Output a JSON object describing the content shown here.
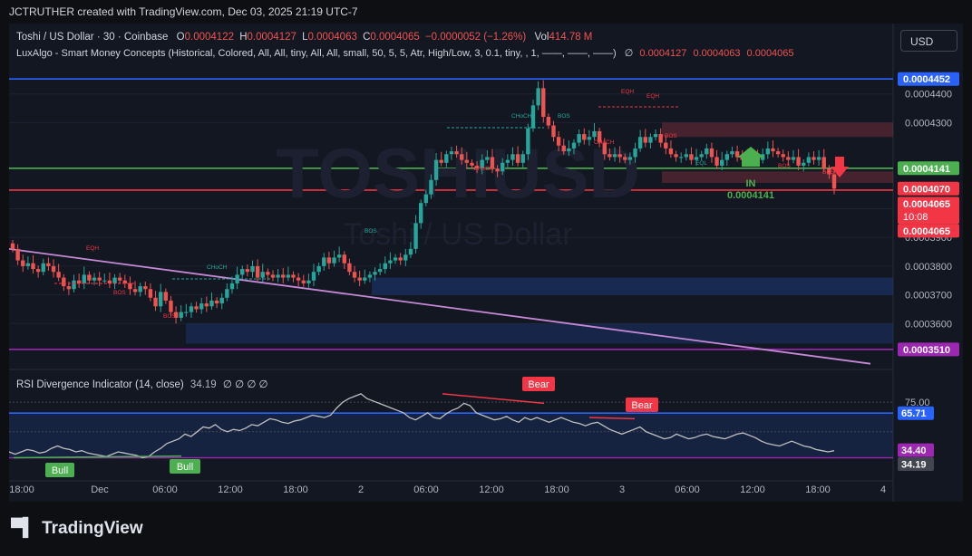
{
  "header": {
    "attribution": "JCTRUTHER created with TradingView.com, Dec 03, 2025 21:19 UTC-7"
  },
  "symbol_legend": {
    "symbol": "Toshi / US Dollar · 30 · Coinbase",
    "o_label": "O",
    "o": "0.0004122",
    "h_label": "H",
    "h": "0.0004127",
    "l_label": "L",
    "l": "0.0004063",
    "c_label": "C",
    "c": "0.0004065",
    "change": "−0.0000052 (−1.26%)",
    "vol_label": "Vol",
    "vol": "414.78 M"
  },
  "indicator_legend": {
    "smc": "LuxAlgo - Smart Money Concepts (Historical, Colored, All, All, tiny, All, All, small, 50, 5, 5, Atr, High/Low, 3, 0.1, tiny, , 1, ——, ——, ——)",
    "smc_values": [
      "∅",
      "0.0004127",
      "0.0004063",
      "0.0004065"
    ],
    "rsi": "RSI Divergence Indicator (14, close)",
    "rsi_value": "34.19",
    "rsi_extra": "∅ ∅ ∅ ∅"
  },
  "currency_button": "USD",
  "watermark": {
    "ticker": "TOSHIUSD",
    "name": "Toshi / US Dollar"
  },
  "colors": {
    "up": "#26a69a",
    "down": "#ef5350",
    "background": "#131722",
    "trendline": "#c689d6",
    "rsi_line": "#c0c0c0",
    "bull_label": "#4caf50",
    "bear_label": "#f23645",
    "blue_line": "#2962ff"
  },
  "annotations": {
    "entry_label": "IN",
    "entry_price": "0.0004141",
    "smc_labels": [
      "EQH",
      "EQH",
      "EQH",
      "CHoCH",
      "CHoCH",
      "CHoCH",
      "CHoCH",
      "BOS",
      "BOS",
      "BOS",
      "BOS",
      "BOS",
      "BOS",
      "BOS",
      "EQL"
    ],
    "rsi_bull": [
      "Bull",
      "Bull"
    ],
    "rsi_bear": [
      "Bear",
      "Bear"
    ]
  },
  "chart_data": {
    "type": "candlestick",
    "price_axis": {
      "range": [
        0.00035,
        0.00045
      ],
      "ticks": [
        "0.0004400",
        "0.0004300",
        "0.0004000",
        "0.0003900",
        "0.0003800",
        "0.0003700",
        "0.0003600"
      ],
      "tick_values": [
        0.00044,
        0.00043,
        0.0004,
        0.00039,
        0.00038,
        0.00037,
        0.00036
      ]
    },
    "price_tags": [
      {
        "text": "0.0004452",
        "value": 0.0004452,
        "color": "#2962ff"
      },
      {
        "text": "0.0004141",
        "value": 0.0004141,
        "color": "#4caf50"
      },
      {
        "text": "0.0004070",
        "value": 0.000407,
        "color": "#f23645"
      },
      {
        "text": "0.0004065",
        "value": 0.0004065,
        "color": "#f23645",
        "sub": "10:08"
      },
      {
        "text": "0.0004065",
        "value": 0.0004065,
        "color": "#f23645"
      },
      {
        "text": "0.0003510",
        "value": 0.000351,
        "color": "#9c27b0"
      }
    ],
    "time_axis": [
      "18:00",
      "Dec",
      "06:00",
      "12:00",
      "18:00",
      "2",
      "06:00",
      "12:00",
      "18:00",
      "3",
      "06:00",
      "12:00",
      "18:00",
      "4"
    ],
    "rsi": {
      "range": [
        20,
        85
      ],
      "ticks": [
        "75.00",
        "25.00"
      ],
      "tick_values": [
        75,
        25
      ],
      "tags": [
        {
          "text": "65.71",
          "value": 65.71,
          "color": "#2962ff"
        },
        {
          "text": "34.40",
          "value": 34.4,
          "color": "#9c27b0"
        },
        {
          "text": "34.19",
          "value": 34.19,
          "color": "#434651"
        }
      ],
      "current": 34.19
    },
    "closes": [
      0.000386,
      0.000382,
      0.00038,
      0.000381,
      0.000379,
      0.000378,
      0.000381,
      0.00038,
      0.000378,
      0.000376,
      0.000373,
      0.000372,
      0.000375,
      0.000374,
      0.000377,
      0.000375,
      0.000376,
      0.000375,
      0.000375,
      0.000374,
      0.000376,
      0.000375,
      0.000374,
      0.000372,
      0.000371,
      0.000373,
      0.000372,
      0.000369,
      0.000366,
      0.000371,
      0.000368,
      0.000364,
      0.000362,
      0.000364,
      0.000364,
      0.000366,
      0.000365,
      0.000367,
      0.000366,
      0.000368,
      0.000367,
      0.000369,
      0.000372,
      0.000374,
      0.000377,
      0.000379,
      0.000378,
      0.00038,
      0.000376,
      0.000378,
      0.000377,
      0.000376,
      0.000377,
      0.000376,
      0.000377,
      0.000376,
      0.000375,
      0.000374,
      0.000375,
      0.000378,
      0.00038,
      0.000383,
      0.000381,
      0.000383,
      0.000384,
      0.000381,
      0.000378,
      0.000376,
      0.000375,
      0.000376,
      0.000377,
      0.000378,
      0.000379,
      0.000381,
      0.000382,
      0.000383,
      0.000382,
      0.000384,
      0.000386,
      0.000395,
      0.000402,
      0.000405,
      0.00041,
      0.000417,
      0.000416,
      0.000419,
      0.00042,
      0.000419,
      0.000417,
      0.000416,
      0.000415,
      0.000414,
      0.000417,
      0.000418,
      0.000414,
      0.000413,
      0.000416,
      0.000417,
      0.000419,
      0.000416,
      0.000419,
      0.000428,
      0.000436,
      0.000442,
      0.000432,
      0.000429,
      0.000425,
      0.000422,
      0.00042,
      0.000421,
      0.000423,
      0.000426,
      0.000424,
      0.000425,
      0.000427,
      0.000423,
      0.000419,
      0.000418,
      0.000419,
      0.000418,
      0.000417,
      0.000418,
      0.000421,
      0.000425,
      0.000423,
      0.000425,
      0.000426,
      0.000423,
      0.000421,
      0.000419,
      0.000418,
      0.000418,
      0.000419,
      0.000417,
      0.000418,
      0.000419,
      0.000421,
      0.000418,
      0.000415,
      0.000417,
      0.000419,
      0.00042,
      0.000418,
      0.000417,
      0.000418,
      0.000419,
      0.000417,
      0.000419,
      0.000421,
      0.00042,
      0.000419,
      0.000418,
      0.000417,
      0.000418,
      0.000415,
      0.000416,
      0.000418,
      0.000417,
      0.000418,
      0.000414,
      0.000412,
      0.000407
    ],
    "rsi_values": [
      33,
      31,
      33,
      35,
      34,
      32,
      33,
      36,
      38,
      36,
      35,
      33,
      34,
      32,
      31,
      30,
      29,
      31,
      33,
      32,
      31,
      30,
      28,
      29,
      33,
      36,
      40,
      42,
      44,
      48,
      46,
      50,
      54,
      53,
      56,
      52,
      50,
      52,
      51,
      53,
      56,
      55,
      58,
      61,
      60,
      58,
      57,
      59,
      60,
      62,
      64,
      63,
      62,
      64,
      70,
      75,
      78,
      80,
      82,
      78,
      76,
      74,
      72,
      70,
      68,
      66,
      62,
      60,
      63,
      66,
      62,
      61,
      65,
      68,
      70,
      74,
      72,
      66,
      64,
      62,
      60,
      61,
      63,
      60,
      58,
      62,
      60,
      62,
      60,
      58,
      60,
      62,
      60,
      58,
      57,
      55,
      57,
      58,
      55,
      52,
      50,
      48,
      50,
      52,
      54,
      50,
      48,
      46,
      44,
      45,
      48,
      46,
      44,
      45,
      47,
      48,
      46,
      45,
      44,
      46,
      48,
      49,
      47,
      45,
      42,
      40,
      39,
      38,
      40,
      42,
      40,
      38,
      37,
      35,
      34,
      33,
      34
    ],
    "support_zones": [
      [
        0.00036,
        0.000353
      ],
      [
        0.000376,
        0.00037
      ]
    ],
    "resistance_zones": [
      [
        0.00043,
        0.000425
      ],
      [
        0.000413,
        0.000409
      ]
    ],
    "horizontal_lines": [
      {
        "value": 0.0004452,
        "color": "#2962ff"
      },
      {
        "value": 0.0004141,
        "color": "#4caf50"
      },
      {
        "value": 0.0004065,
        "color": "#f23645"
      },
      {
        "value": 0.000351,
        "color": "#9c27b0"
      }
    ],
    "trendline": {
      "from": 0.000386,
      "to": 0.000346
    }
  }
}
